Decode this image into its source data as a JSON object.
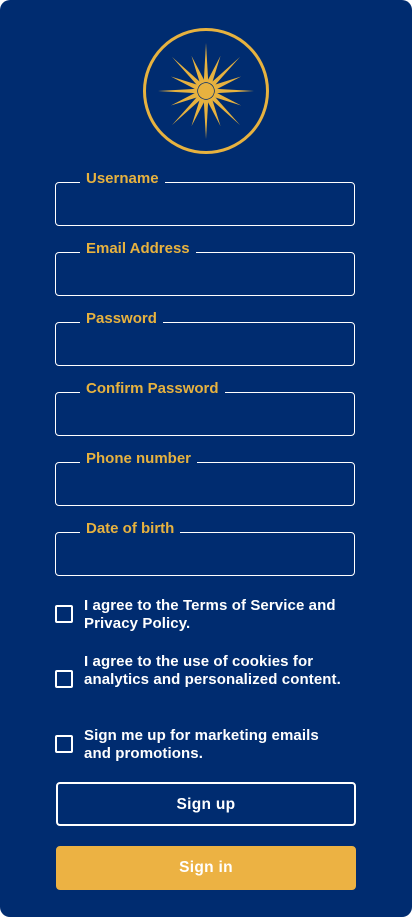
{
  "theme": {
    "background": "#002c70",
    "accent": "#e7b23f",
    "button_accent": "#ecb243",
    "text": "#ffffff"
  },
  "logo": {
    "icon": "vergina-sun-icon"
  },
  "fields": [
    {
      "label": "Username",
      "value": ""
    },
    {
      "label": "Email Address",
      "value": ""
    },
    {
      "label": "Password",
      "value": ""
    },
    {
      "label": "Confirm Password",
      "value": ""
    },
    {
      "label": "Phone number",
      "value": ""
    },
    {
      "label": "Date of birth",
      "value": ""
    }
  ],
  "checkboxes": [
    {
      "label": "I agree to the Terms of Service and Privacy Policy.",
      "checked": false
    },
    {
      "label": "I agree to the use of cookies for analytics and personalized content.",
      "checked": false
    },
    {
      "label": "Sign me up for marketing emails and promotions.",
      "checked": false
    }
  ],
  "buttons": {
    "signup_label": "Sign up",
    "signin_label": "Sign in"
  }
}
